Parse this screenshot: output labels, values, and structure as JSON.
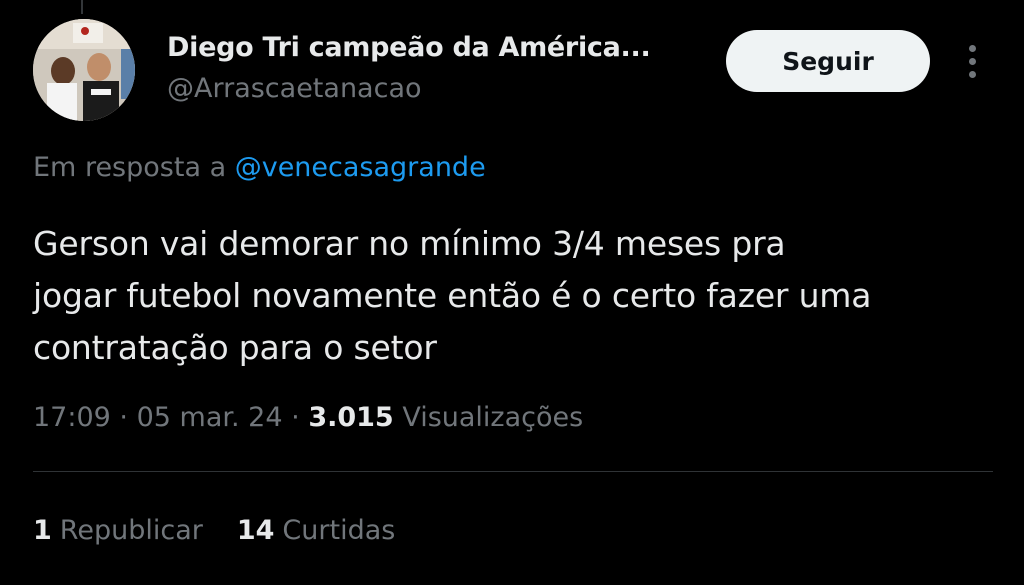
{
  "author": {
    "display_name": "Diego Tri campeão da América...",
    "handle": "@Arrascaetanacao"
  },
  "follow_button": {
    "label": "Seguir"
  },
  "reply": {
    "prefix": "Em resposta a",
    "mention": "@venecasagrande"
  },
  "tweet": {
    "text": "Gerson vai demorar no mínimo 3/4 meses pra\njogar futebol novamente então é o certo fazer uma\ncontratação para o setor"
  },
  "meta": {
    "time": "17:09",
    "separator": "·",
    "date": "05 mar. 24",
    "views_count": "3.015",
    "views_label": "Visualizações"
  },
  "stats": {
    "reposts_count": "1",
    "reposts_label": "Republicar",
    "likes_count": "14",
    "likes_label": "Curtidas"
  },
  "colors": {
    "background": "#000000",
    "primary_text": "#e7e9ea",
    "secondary_text": "#71767b",
    "link": "#1d9bf0",
    "button_bg": "#eff3f4"
  }
}
